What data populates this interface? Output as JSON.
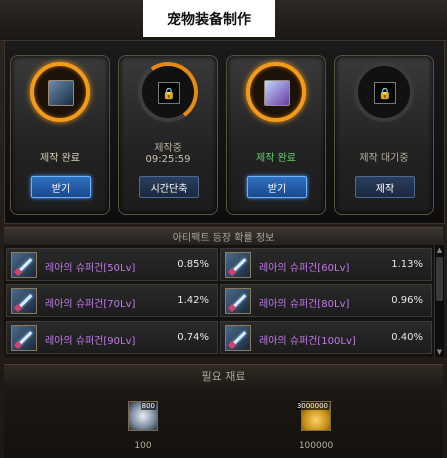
{
  "title": "宠物装备制作",
  "slots": [
    {
      "status": "제작 완료",
      "status_color": "#d8d0b8",
      "timer": "",
      "button": "받기",
      "state": "done",
      "icon": "sword-icon"
    },
    {
      "status": "제작중",
      "status_color": "#b8b0a0",
      "timer": "09:25:59",
      "button": "시간단축",
      "state": "progress",
      "icon": "lock-icon"
    },
    {
      "status": "제작 완료",
      "status_color": "#66d070",
      "timer": "",
      "button": "받기",
      "state": "done",
      "icon": "sword-icon"
    },
    {
      "status": "제작 대기중",
      "status_color": "#b8b0a0",
      "timer": "",
      "button": "제작",
      "state": "idle",
      "icon": "lock-icon"
    }
  ],
  "probability_header": "아티팩트 등장 확률 정보",
  "items": [
    {
      "name": "레아의 슈퍼건[50Lv]",
      "pct": "0.85%"
    },
    {
      "name": "레아의 슈퍼건[60Lv]",
      "pct": "1.13%"
    },
    {
      "name": "레아의 슈퍼건[70Lv]",
      "pct": "1.42%"
    },
    {
      "name": "레아의 슈퍼건[80Lv]",
      "pct": "0.96%"
    },
    {
      "name": "레아의 슈퍼건[90Lv]",
      "pct": "0.74%"
    },
    {
      "name": "레아의 슈퍼건[100Lv]",
      "pct": "0.40%"
    }
  ],
  "materials_header": "필요 재료",
  "materials": [
    {
      "qty_badge": "800",
      "amount": "100",
      "icon": "crystal-icon"
    },
    {
      "qty_badge": "3000000",
      "amount": "100000",
      "icon": "gold-coins-icon"
    }
  ]
}
